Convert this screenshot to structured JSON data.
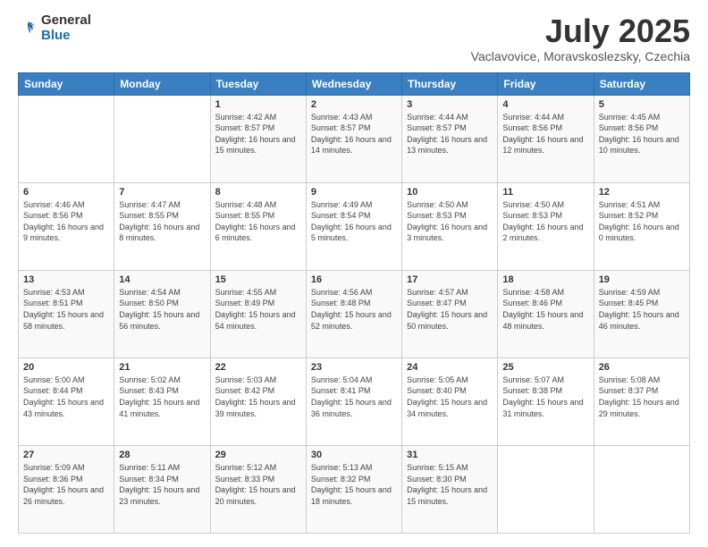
{
  "logo": {
    "general": "General",
    "blue": "Blue"
  },
  "header": {
    "title": "July 2025",
    "subtitle": "Vaclavovice, Moravskoslezsky, Czechia"
  },
  "weekdays": [
    "Sunday",
    "Monday",
    "Tuesday",
    "Wednesday",
    "Thursday",
    "Friday",
    "Saturday"
  ],
  "weeks": [
    [
      {
        "day": "",
        "info": ""
      },
      {
        "day": "",
        "info": ""
      },
      {
        "day": "1",
        "info": "Sunrise: 4:42 AM\nSunset: 8:57 PM\nDaylight: 16 hours and 15 minutes."
      },
      {
        "day": "2",
        "info": "Sunrise: 4:43 AM\nSunset: 8:57 PM\nDaylight: 16 hours and 14 minutes."
      },
      {
        "day": "3",
        "info": "Sunrise: 4:44 AM\nSunset: 8:57 PM\nDaylight: 16 hours and 13 minutes."
      },
      {
        "day": "4",
        "info": "Sunrise: 4:44 AM\nSunset: 8:56 PM\nDaylight: 16 hours and 12 minutes."
      },
      {
        "day": "5",
        "info": "Sunrise: 4:45 AM\nSunset: 8:56 PM\nDaylight: 16 hours and 10 minutes."
      }
    ],
    [
      {
        "day": "6",
        "info": "Sunrise: 4:46 AM\nSunset: 8:56 PM\nDaylight: 16 hours and 9 minutes."
      },
      {
        "day": "7",
        "info": "Sunrise: 4:47 AM\nSunset: 8:55 PM\nDaylight: 16 hours and 8 minutes."
      },
      {
        "day": "8",
        "info": "Sunrise: 4:48 AM\nSunset: 8:55 PM\nDaylight: 16 hours and 6 minutes."
      },
      {
        "day": "9",
        "info": "Sunrise: 4:49 AM\nSunset: 8:54 PM\nDaylight: 16 hours and 5 minutes."
      },
      {
        "day": "10",
        "info": "Sunrise: 4:50 AM\nSunset: 8:53 PM\nDaylight: 16 hours and 3 minutes."
      },
      {
        "day": "11",
        "info": "Sunrise: 4:50 AM\nSunset: 8:53 PM\nDaylight: 16 hours and 2 minutes."
      },
      {
        "day": "12",
        "info": "Sunrise: 4:51 AM\nSunset: 8:52 PM\nDaylight: 16 hours and 0 minutes."
      }
    ],
    [
      {
        "day": "13",
        "info": "Sunrise: 4:53 AM\nSunset: 8:51 PM\nDaylight: 15 hours and 58 minutes."
      },
      {
        "day": "14",
        "info": "Sunrise: 4:54 AM\nSunset: 8:50 PM\nDaylight: 15 hours and 56 minutes."
      },
      {
        "day": "15",
        "info": "Sunrise: 4:55 AM\nSunset: 8:49 PM\nDaylight: 15 hours and 54 minutes."
      },
      {
        "day": "16",
        "info": "Sunrise: 4:56 AM\nSunset: 8:48 PM\nDaylight: 15 hours and 52 minutes."
      },
      {
        "day": "17",
        "info": "Sunrise: 4:57 AM\nSunset: 8:47 PM\nDaylight: 15 hours and 50 minutes."
      },
      {
        "day": "18",
        "info": "Sunrise: 4:58 AM\nSunset: 8:46 PM\nDaylight: 15 hours and 48 minutes."
      },
      {
        "day": "19",
        "info": "Sunrise: 4:59 AM\nSunset: 8:45 PM\nDaylight: 15 hours and 46 minutes."
      }
    ],
    [
      {
        "day": "20",
        "info": "Sunrise: 5:00 AM\nSunset: 8:44 PM\nDaylight: 15 hours and 43 minutes."
      },
      {
        "day": "21",
        "info": "Sunrise: 5:02 AM\nSunset: 8:43 PM\nDaylight: 15 hours and 41 minutes."
      },
      {
        "day": "22",
        "info": "Sunrise: 5:03 AM\nSunset: 8:42 PM\nDaylight: 15 hours and 39 minutes."
      },
      {
        "day": "23",
        "info": "Sunrise: 5:04 AM\nSunset: 8:41 PM\nDaylight: 15 hours and 36 minutes."
      },
      {
        "day": "24",
        "info": "Sunrise: 5:05 AM\nSunset: 8:40 PM\nDaylight: 15 hours and 34 minutes."
      },
      {
        "day": "25",
        "info": "Sunrise: 5:07 AM\nSunset: 8:38 PM\nDaylight: 15 hours and 31 minutes."
      },
      {
        "day": "26",
        "info": "Sunrise: 5:08 AM\nSunset: 8:37 PM\nDaylight: 15 hours and 29 minutes."
      }
    ],
    [
      {
        "day": "27",
        "info": "Sunrise: 5:09 AM\nSunset: 8:36 PM\nDaylight: 15 hours and 26 minutes."
      },
      {
        "day": "28",
        "info": "Sunrise: 5:11 AM\nSunset: 8:34 PM\nDaylight: 15 hours and 23 minutes."
      },
      {
        "day": "29",
        "info": "Sunrise: 5:12 AM\nSunset: 8:33 PM\nDaylight: 15 hours and 20 minutes."
      },
      {
        "day": "30",
        "info": "Sunrise: 5:13 AM\nSunset: 8:32 PM\nDaylight: 15 hours and 18 minutes."
      },
      {
        "day": "31",
        "info": "Sunrise: 5:15 AM\nSunset: 8:30 PM\nDaylight: 15 hours and 15 minutes."
      },
      {
        "day": "",
        "info": ""
      },
      {
        "day": "",
        "info": ""
      }
    ]
  ]
}
